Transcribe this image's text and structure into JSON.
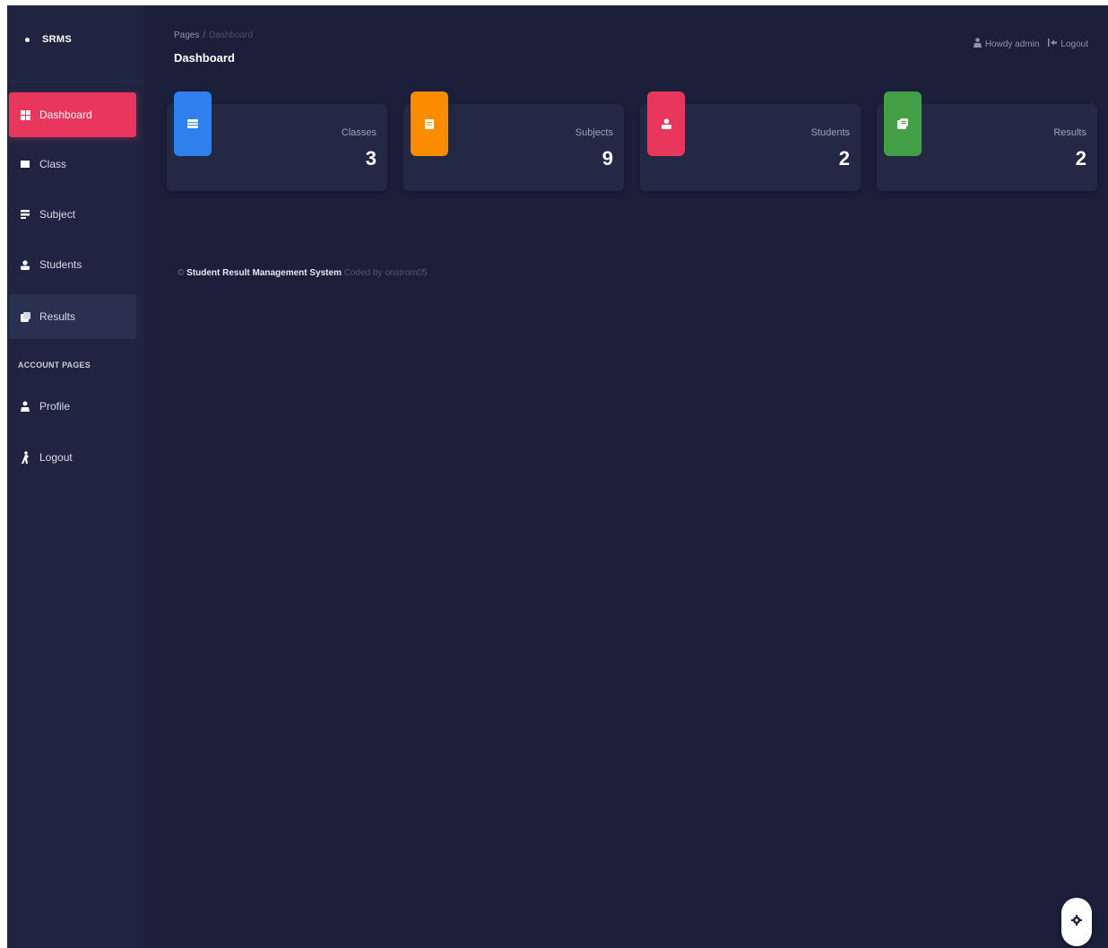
{
  "brand": {
    "name": "SRMS"
  },
  "sidebar": {
    "items": [
      {
        "label": "Dashboard",
        "icon": "dashboard-icon"
      },
      {
        "label": "Class",
        "icon": "class-icon"
      },
      {
        "label": "Subject",
        "icon": "subject-icon"
      },
      {
        "label": "Students",
        "icon": "students-icon"
      },
      {
        "label": "Results",
        "icon": "results-icon"
      }
    ],
    "section_label": "ACCOUNT PAGES",
    "account_items": [
      {
        "label": "Profile",
        "icon": "profile-icon"
      },
      {
        "label": "Logout",
        "icon": "logout-icon"
      }
    ]
  },
  "header": {
    "breadcrumb_root": "Pages",
    "breadcrumb_separator": "/",
    "breadcrumb_current": "Dashboard",
    "title": "Dashboard",
    "greeting": "Howdy admin",
    "logout_label": "Logout"
  },
  "cards": [
    {
      "label": "Classes",
      "value": "3",
      "color": "#2f80ed",
      "icon": "classes-icon"
    },
    {
      "label": "Subjects",
      "value": "9",
      "color": "#fb8c00",
      "icon": "subjects-icon"
    },
    {
      "label": "Students",
      "value": "2",
      "color": "#e8365d",
      "icon": "students-icon"
    },
    {
      "label": "Results",
      "value": "2",
      "color": "#43a047",
      "icon": "results-icon"
    }
  ],
  "footer": {
    "copyright": "©",
    "app_name": "Student Result Management System",
    "credit": "Coded by onstrom05"
  },
  "colors": {
    "background": "#1c1f3a",
    "sidebar": "#1f2541",
    "accent": "#e8365d"
  }
}
